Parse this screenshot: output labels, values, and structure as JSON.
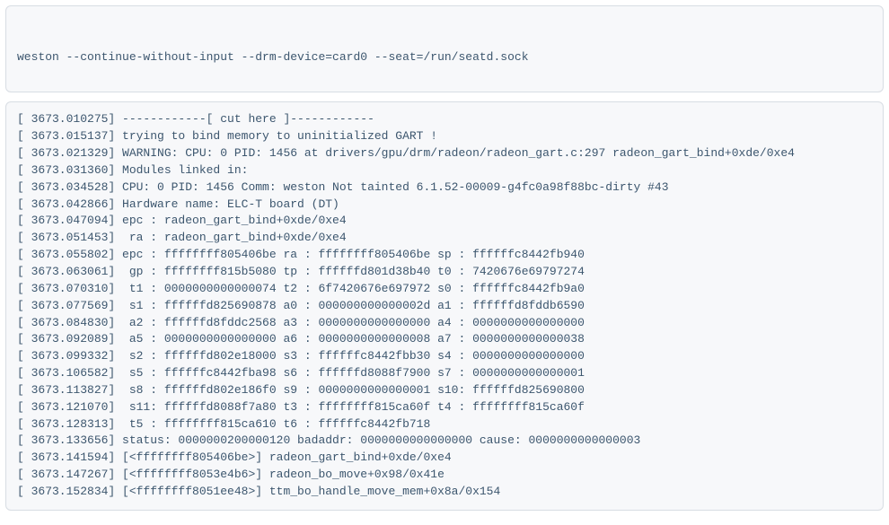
{
  "command": "weston --continue-without-input --drm-device=card0 --seat=/run/seatd.sock",
  "log": [
    "[ 3673.010275] ------------[ cut here ]------------",
    "[ 3673.015137] trying to bind memory to uninitialized GART !",
    "[ 3673.021329] WARNING: CPU: 0 PID: 1456 at drivers/gpu/drm/radeon/radeon_gart.c:297 radeon_gart_bind+0xde/0xe4",
    "[ 3673.031360] Modules linked in:",
    "[ 3673.034528] CPU: 0 PID: 1456 Comm: weston Not tainted 6.1.52-00009-g4fc0a98f88bc-dirty #43",
    "[ 3673.042866] Hardware name: ELC-T board (DT)",
    "[ 3673.047094] epc : radeon_gart_bind+0xde/0xe4",
    "[ 3673.051453]  ra : radeon_gart_bind+0xde/0xe4",
    "[ 3673.055802] epc : ffffffff805406be ra : ffffffff805406be sp : ffffffc8442fb940",
    "[ 3673.063061]  gp : ffffffff815b5080 tp : ffffffd801d38b40 t0 : 7420676e69797274",
    "[ 3673.070310]  t1 : 0000000000000074 t2 : 6f7420676e697972 s0 : ffffffc8442fb9a0",
    "[ 3673.077569]  s1 : ffffffd825690878 a0 : 000000000000002d a1 : ffffffd8fddb6590",
    "[ 3673.084830]  a2 : ffffffd8fddc2568 a3 : 0000000000000000 a4 : 0000000000000000",
    "[ 3673.092089]  a5 : 0000000000000000 a6 : 0000000000000008 a7 : 0000000000000038",
    "[ 3673.099332]  s2 : ffffffd802e18000 s3 : ffffffc8442fbb30 s4 : 0000000000000000",
    "[ 3673.106582]  s5 : ffffffc8442fba98 s6 : ffffffd8088f7900 s7 : 0000000000000001",
    "[ 3673.113827]  s8 : ffffffd802e186f0 s9 : 0000000000000001 s10: ffffffd825690800",
    "[ 3673.121070]  s11: ffffffd8088f7a80 t3 : ffffffff815ca60f t4 : ffffffff815ca60f",
    "[ 3673.128313]  t5 : ffffffff815ca610 t6 : ffffffc8442fb718",
    "[ 3673.133656] status: 0000000200000120 badaddr: 0000000000000000 cause: 0000000000000003",
    "[ 3673.141594] [<ffffffff805406be>] radeon_gart_bind+0xde/0xe4",
    "[ 3673.147267] [<ffffffff8053e4b6>] radeon_bo_move+0x98/0x41e",
    "[ 3673.152834] [<ffffffff8051ee48>] ttm_bo_handle_move_mem+0x8a/0x154"
  ]
}
